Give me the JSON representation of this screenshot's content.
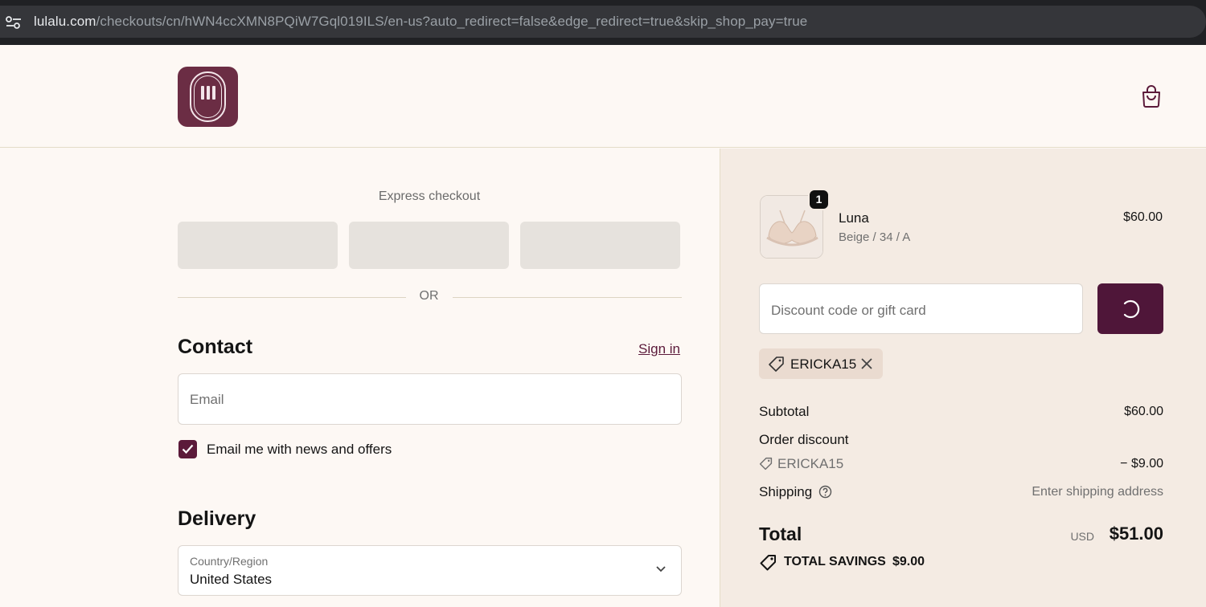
{
  "browser": {
    "url_host": "lulalu.com",
    "url_path": "/checkouts/cn/hWN4ccXMN8PQiW7Gql019ILS/en-us?auto_redirect=false&edge_redirect=true&skip_shop_pay=true",
    "site_info_icon": "tune-icon"
  },
  "header": {
    "logo_icon": "brand-logo",
    "cart_icon": "shopping-bag-icon"
  },
  "checkout": {
    "express_title": "Express checkout",
    "express_buttons": [
      "",
      "",
      ""
    ],
    "or_label": "OR",
    "contact": {
      "title": "Contact",
      "sign_in": "Sign in",
      "email_placeholder": "Email",
      "newsletter_label": "Email me with news and offers",
      "newsletter_checked": true
    },
    "delivery": {
      "title": "Delivery",
      "country_label": "Country/Region",
      "country_value": "United States"
    }
  },
  "summary": {
    "item": {
      "name": "Luna",
      "variant": "Beige / 34 / A",
      "price": "$60.00",
      "quantity": "1"
    },
    "discount_placeholder": "Discount code or gift card",
    "applied_code": "ERICKA15",
    "subtotal_label": "Subtotal",
    "subtotal_value": "$60.00",
    "order_discount_label": "Order discount",
    "order_discount_code": "ERICKA15",
    "order_discount_value": "− $9.00",
    "shipping_label": "Shipping",
    "shipping_value": "Enter shipping address",
    "total_label": "Total",
    "currency": "USD",
    "total_value": "$51.00",
    "savings_label": "TOTAL SAVINGS",
    "savings_value": "$9.00"
  },
  "colors": {
    "accent": "#5b1a3a",
    "page_bg": "#fdf8f4",
    "summary_bg": "#f4ebe3"
  }
}
